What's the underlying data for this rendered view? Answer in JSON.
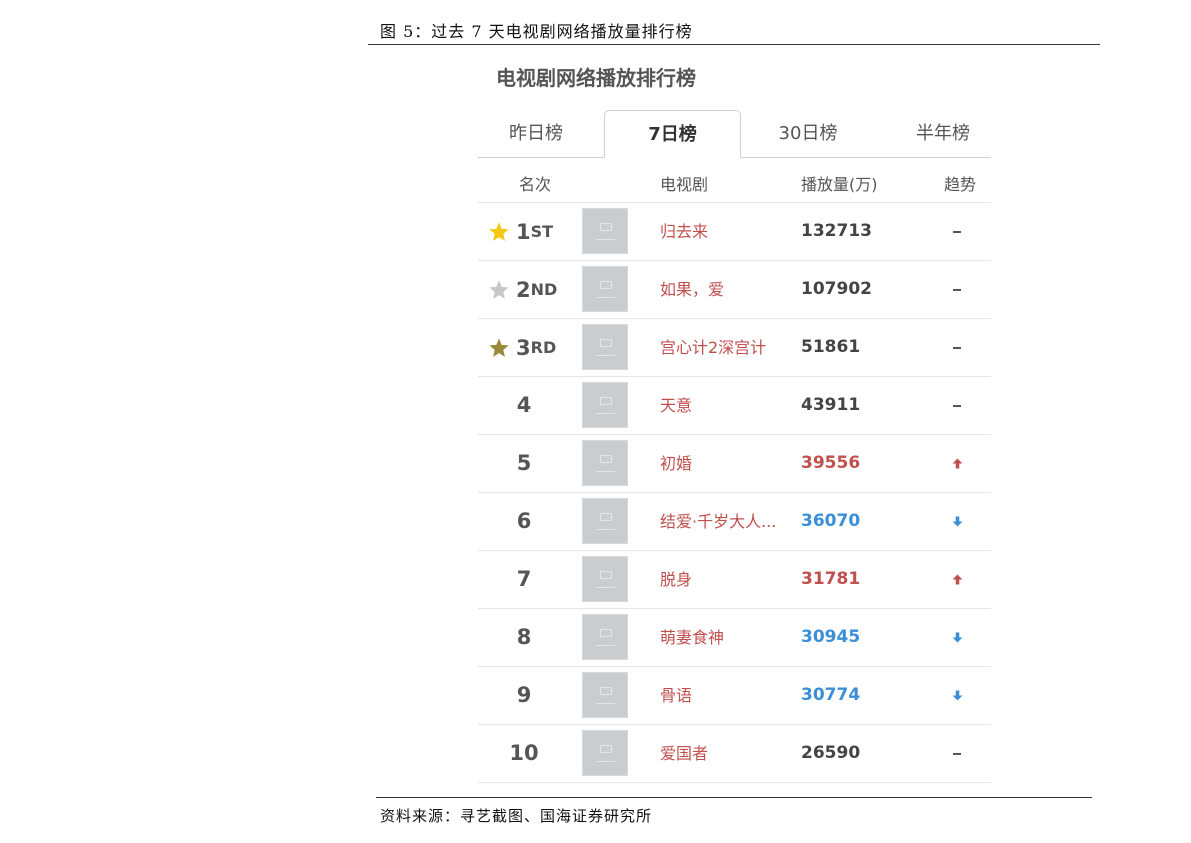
{
  "figure": {
    "caption": "图 5：过去 7 天电视剧网络播放量排行榜",
    "source": "资料来源：寻艺截图、国海证券研究所"
  },
  "widget": {
    "title": "电视剧网络播放排行榜",
    "tabs": [
      {
        "label": "昨日榜",
        "active": false
      },
      {
        "label": "7日榜",
        "active": true
      },
      {
        "label": "30日榜",
        "active": false
      },
      {
        "label": "半年榜",
        "active": false
      }
    ],
    "columns": {
      "rank": "名次",
      "drama": "电视剧",
      "plays": "播放量(万)",
      "trend": "趋势"
    },
    "rows": [
      {
        "rank_num": "1",
        "rank_suffix": "ST",
        "star_color": "#f2c811",
        "name": "归去来",
        "plays": "132713",
        "trend": "flat"
      },
      {
        "rank_num": "2",
        "rank_suffix": "ND",
        "star_color": "#c8c8c8",
        "name": "如果，爱",
        "plays": "107902",
        "trend": "flat"
      },
      {
        "rank_num": "3",
        "rank_suffix": "RD",
        "star_color": "#9a8a3c",
        "name": "宫心计2深宫计",
        "plays": "51861",
        "trend": "flat"
      },
      {
        "rank_num": "4",
        "rank_suffix": "",
        "star_color": "",
        "name": "天意",
        "plays": "43911",
        "trend": "flat"
      },
      {
        "rank_num": "5",
        "rank_suffix": "",
        "star_color": "",
        "name": "初婚",
        "plays": "39556",
        "trend": "up"
      },
      {
        "rank_num": "6",
        "rank_suffix": "",
        "star_color": "",
        "name": "结爱·千岁大人...",
        "plays": "36070",
        "trend": "down"
      },
      {
        "rank_num": "7",
        "rank_suffix": "",
        "star_color": "",
        "name": "脱身",
        "plays": "31781",
        "trend": "up"
      },
      {
        "rank_num": "8",
        "rank_suffix": "",
        "star_color": "",
        "name": "萌妻食神",
        "plays": "30945",
        "trend": "down"
      },
      {
        "rank_num": "9",
        "rank_suffix": "",
        "star_color": "",
        "name": "骨语",
        "plays": "30774",
        "trend": "down"
      },
      {
        "rank_num": "10",
        "rank_suffix": "",
        "star_color": "",
        "name": "爱国者",
        "plays": "26590",
        "trend": "flat"
      }
    ],
    "icons": {
      "star": "star-icon",
      "thumbnail": "image-placeholder-icon",
      "trend_up": "arrow-up-icon",
      "trend_down": "arrow-down-icon",
      "trend_flat": "dash-icon"
    },
    "colors": {
      "up": "#c0504d",
      "down": "#3a8fd6",
      "link": "#c0504d"
    }
  }
}
